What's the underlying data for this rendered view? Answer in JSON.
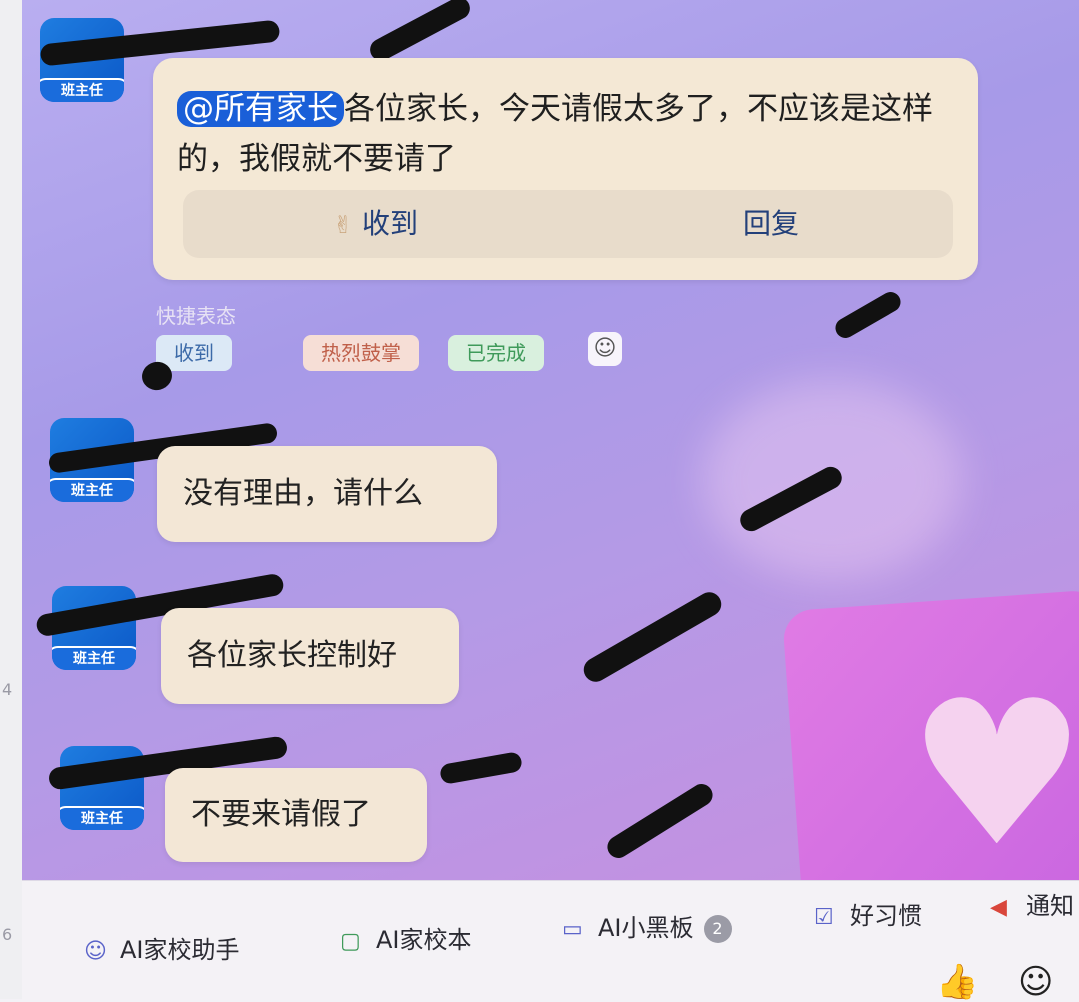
{
  "left_strip": {
    "digits": [
      "4",
      "6"
    ]
  },
  "notice": {
    "mention": "@所有家长",
    "text": "各位家长，今天请假太多了，不应该是这样的，我假就不要请了",
    "ack_label": "收到",
    "reply_label": "回复"
  },
  "reactions": {
    "label": "快捷表态",
    "chips": [
      "收到",
      "热烈鼓掌",
      "已完成"
    ]
  },
  "role_badge": "班主任",
  "messages": [
    {
      "text": "没有理由，请什么"
    },
    {
      "text": "各位家长控制好"
    },
    {
      "text": "不要来请假了"
    }
  ],
  "toolbar": {
    "items": [
      {
        "label": "AI家校助手",
        "icon": "robot-icon"
      },
      {
        "label": "AI家校本",
        "icon": "notebook-icon"
      },
      {
        "label": "AI小黑板",
        "icon": "board-icon",
        "badge": "2"
      },
      {
        "label": "好习惯",
        "icon": "calendar-check-icon"
      },
      {
        "label": "通知",
        "icon": "megaphone-icon"
      }
    ]
  },
  "colors": {
    "bubble": "#f3e7d6",
    "mention": "#1a5fd8",
    "role_badge": "#1a6cdc",
    "chat_bg": "#a79ae8"
  }
}
